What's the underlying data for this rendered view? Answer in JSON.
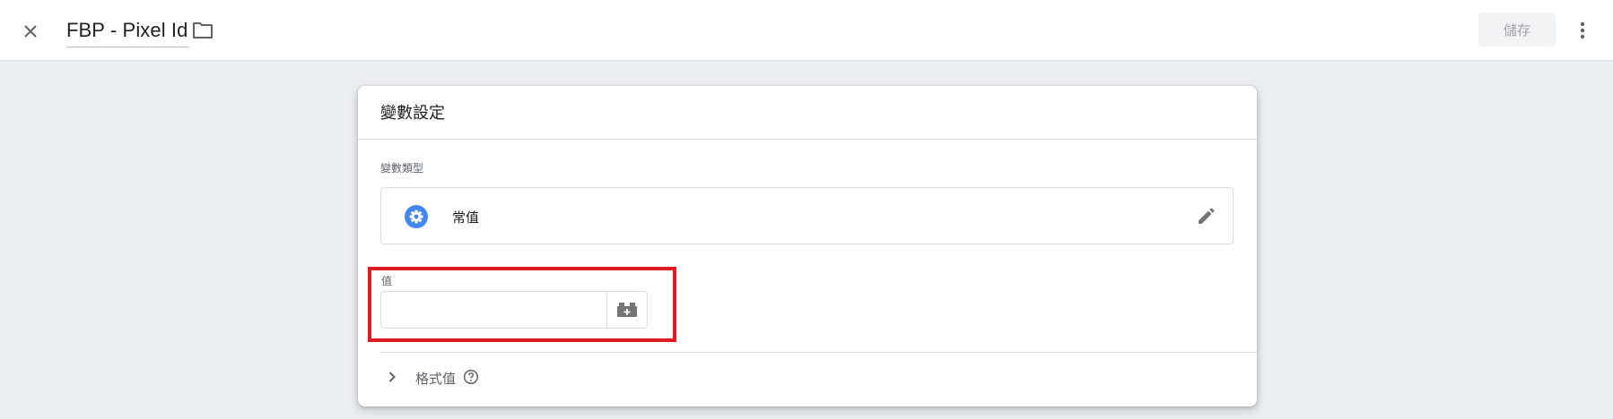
{
  "header": {
    "title": "FBP - Pixel Id",
    "save_label": "儲存",
    "close_icon": "close-icon",
    "folder_icon": "folder-icon",
    "more_icon": "more-vert-icon"
  },
  "card": {
    "title": "變數設定",
    "variable_type_label": "變數類型",
    "variable_type": {
      "name": "常值",
      "icon": "gear-icon",
      "icon_color": "#4285f4",
      "edit_icon": "pencil-icon"
    },
    "value": {
      "label": "值",
      "current_value": "",
      "placeholder": "",
      "picker_icon": "variable-picker-icon"
    },
    "format": {
      "label": "格式值",
      "expanded": false,
      "help_icon": "help-icon"
    }
  },
  "colors": {
    "highlight": "#e01b24",
    "accent": "#4285f4",
    "background": "#eceff1"
  }
}
